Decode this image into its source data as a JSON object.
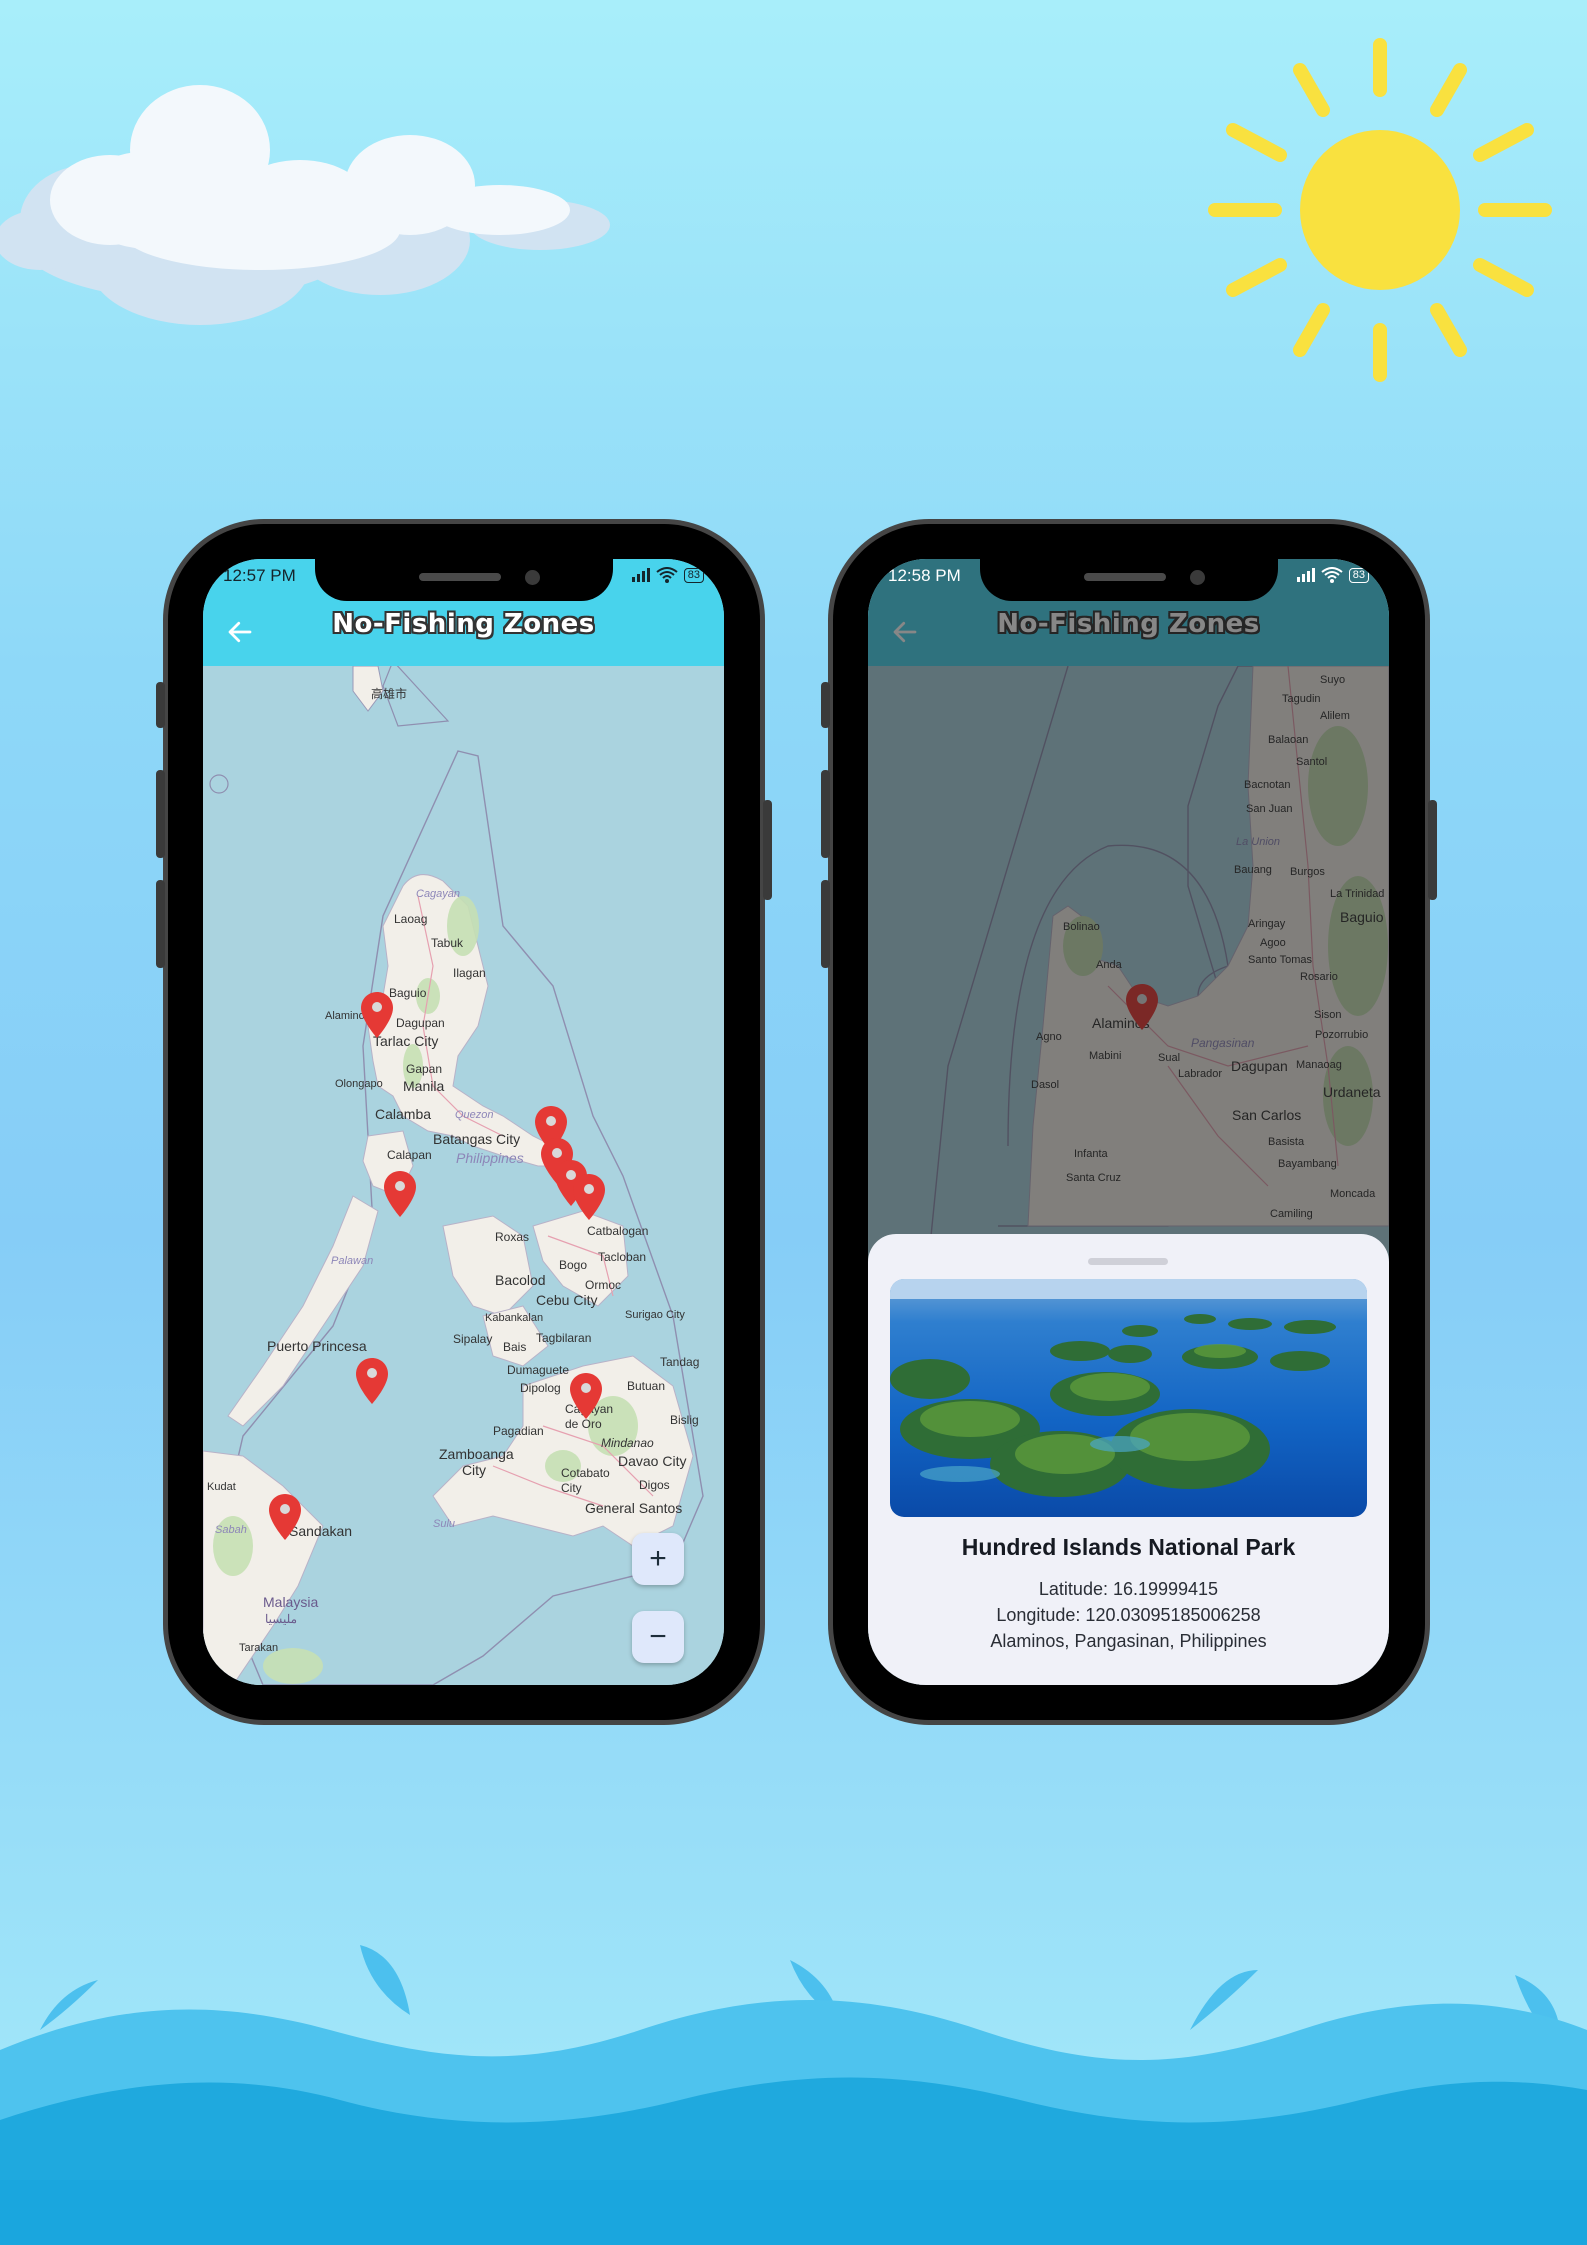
{
  "colors": {
    "appbar": "#48d3ec",
    "marker": "#e53935",
    "sea": "#aad3df",
    "land": "#f2efe9",
    "sheet": "#f0f1f8"
  },
  "phone_left": {
    "status": {
      "time": "12:57 PM",
      "battery": "83"
    },
    "appbar": {
      "title": "No-Fishing Zones",
      "back_icon": "arrow-left-icon"
    },
    "map": {
      "labels": [
        "高雄市",
        "Cagayan",
        "Laoag",
        "Tabuk",
        "Ilagan",
        "Baguio",
        "Alaminos",
        "Dagupan",
        "Tarlac City",
        "Gapan",
        "Olongapo",
        "Manila",
        "Calamba",
        "Quezon",
        "Batangas City",
        "Calapan",
        "Philippines",
        "Roxas",
        "Palawan",
        "Bacolod",
        "Bogo",
        "Catbalogan",
        "Tacloban",
        "Ormoc",
        "Cebu City",
        "Kabankalan",
        "Surigao City",
        "Puerto Princesa",
        "Sipalay",
        "Bais",
        "Tagbilaran",
        "Dumaguete",
        "Tandag",
        "Dipolog",
        "Cagayan de Oro",
        "Butuan",
        "Bislig",
        "Zamboanga City",
        "Pagadian",
        "Mindanao",
        "Davao City",
        "Cotabato City",
        "Digos",
        "General Santos",
        "Kudat",
        "Sabah",
        "Sandakan",
        "Sulu",
        "Malaysia",
        "مليسيا",
        "Tarakan"
      ],
      "markers_count": 9
    },
    "zoom": {
      "in_label": "+",
      "out_label": "−"
    }
  },
  "phone_right": {
    "status": {
      "time": "12:58 PM",
      "battery": "83"
    },
    "appbar": {
      "title": "No-Fishing Zones",
      "back_icon": "arrow-left-icon"
    },
    "map": {
      "labels": [
        "Suyo",
        "Tagudin",
        "Alilem",
        "Balaoan",
        "Santol",
        "Bacnotan",
        "San Juan",
        "La Union",
        "Bauang",
        "Burgos",
        "La Trinidad",
        "Baguio",
        "Aringay",
        "Agoo",
        "Santo Tomas",
        "Rosario",
        "Bolinao",
        "Anda",
        "Alaminos",
        "Agno",
        "Mabini",
        "Sual",
        "Labrador",
        "Pangasinan",
        "Dagupan",
        "Manaoag",
        "Pozorrubio",
        "Urdaneta",
        "Dasol",
        "San Carlos",
        "Basista",
        "Bayambang",
        "Infanta",
        "Santa Cruz",
        "Moncada",
        "Camiling",
        "Sison"
      ]
    },
    "sheet": {
      "place_name": "Hundred Islands National Park",
      "latitude": "Latitude: 16.19999415",
      "longitude": "Longitude: 120.03095185006258",
      "address": "Alaminos, Pangasinan, Philippines"
    }
  }
}
